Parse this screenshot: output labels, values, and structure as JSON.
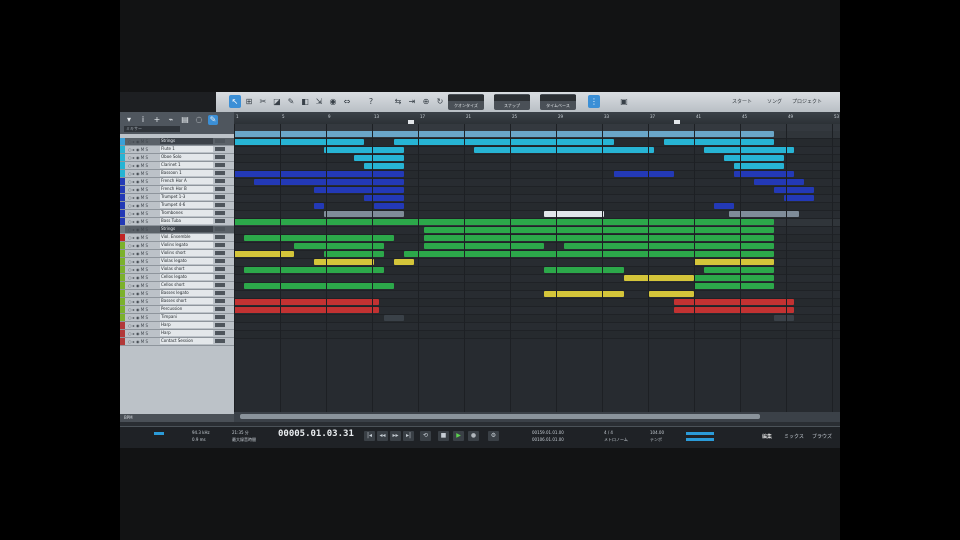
{
  "toolbar": {
    "modes": [
      {
        "top": "",
        "bottom": "クオンタイズ"
      },
      {
        "top": "",
        "bottom": "スナップ"
      },
      {
        "top": "",
        "bottom": "タイムベース"
      }
    ],
    "nav": [
      "スタート",
      "ソング",
      "プロジェクト"
    ]
  },
  "left_panel": {
    "filter_label": "ミキサー",
    "bottom_label": "BPM"
  },
  "tracks": [
    {
      "name": "Strings",
      "color": "#3aa0d8",
      "folder": true
    },
    {
      "name": "Flute 1",
      "color": "#27b4d4"
    },
    {
      "name": "Oboe Solo",
      "color": "#27b4d4"
    },
    {
      "name": "Clarinet 1",
      "color": "#27b4d4"
    },
    {
      "name": "Bassoon 1",
      "color": "#27b4d4"
    },
    {
      "name": "French Hor A",
      "color": "#2339b6"
    },
    {
      "name": "French Hor B",
      "color": "#2339b6"
    },
    {
      "name": "Trumpet 1-3",
      "color": "#2339b6"
    },
    {
      "name": "Trumpet 4-6",
      "color": "#2339b6"
    },
    {
      "name": "Trombones",
      "color": "#2339b6"
    },
    {
      "name": "Bass Tuba",
      "color": "#2339b6"
    },
    {
      "name": "Strings",
      "color": "#6f7980",
      "folder": true
    },
    {
      "name": "Viol. Ensemble",
      "color": "#c02424"
    },
    {
      "name": "Violins legato",
      "color": "#7bb12b"
    },
    {
      "name": "Violins short",
      "color": "#7bb12b"
    },
    {
      "name": "Violas legato",
      "color": "#7bb12b"
    },
    {
      "name": "Violas short",
      "color": "#7bb12b"
    },
    {
      "name": "Cellos legato",
      "color": "#7bb12b"
    },
    {
      "name": "Cellos short",
      "color": "#7bb12b"
    },
    {
      "name": "Basses legato",
      "color": "#7bb12b"
    },
    {
      "name": "Basses short",
      "color": "#7bb12b"
    },
    {
      "name": "Percussion",
      "color": "#7bb12b"
    },
    {
      "name": "Timpani",
      "color": "#7bb12b"
    },
    {
      "name": "Harp",
      "color": "#b23838"
    },
    {
      "name": "Harp",
      "color": "#b23838"
    },
    {
      "name": "Contact Session",
      "color": "#b23838"
    }
  ],
  "ruler": [
    "1",
    "5",
    "9",
    "13",
    "17",
    "21",
    "25",
    "29",
    "33",
    "37",
    "41",
    "45",
    "49",
    "53"
  ],
  "transport": {
    "cpu": "94.3 kHz",
    "latency": "0.9 ms",
    "time_label": "21:35 分",
    "record_label": "最大録音時間",
    "time": "00005.01.03.31",
    "loop_start": "00159.01.01.00",
    "loop_end": "00106.01.01.00",
    "signature": "4 / 4",
    "tempo": "104.00",
    "metronome": "メトロノーム",
    "tempo_label": "テンポ",
    "tabs": [
      "編集",
      "ミックス",
      "ブラウズ"
    ]
  },
  "colors": {
    "cyan": "#27b4d4",
    "blue": "#2339b6",
    "green": "#2ca84a",
    "yellow": "#d4c53a",
    "red": "#c23232"
  }
}
